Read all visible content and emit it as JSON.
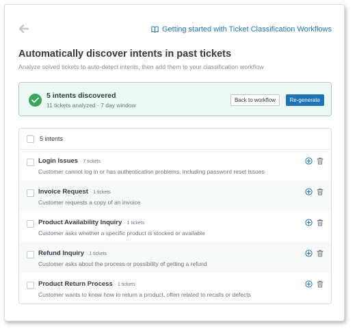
{
  "header": {
    "help_link": "Getting started with Ticket Classification Workflows"
  },
  "page": {
    "title": "Automatically discover intents in past tickets",
    "subtitle": "Analyze solved tickets to auto-detect intents, then add them to your classification workflow"
  },
  "result": {
    "title": "5 intents discovered",
    "subtitle": "11 tickets analyzed · 7 day window",
    "back_label": "Back to workflow",
    "regenerate_label": "Re-generate"
  },
  "list": {
    "header_label": "5 intents",
    "items": [
      {
        "name": "Login Issues",
        "count": "· 7 tickets",
        "description": "Customer cannot log in or has authentication problems, including password reset issues"
      },
      {
        "name": "Invoice Request",
        "count": "· 1 tickets",
        "description": "Customer requests a copy of an invoice"
      },
      {
        "name": "Product Availability Inquiry",
        "count": "· 1 tickets",
        "description": "Customer asks whether a specific product is stocked or available"
      },
      {
        "name": "Refund Inquiry",
        "count": "· 1 tickets",
        "description": "Customer asks about the process or possibility of getting a refund"
      },
      {
        "name": "Product Return Process",
        "count": "· 1 tickets",
        "description": "Customer wants to know how to return a product, often related to recalls or defects"
      }
    ]
  },
  "colors": {
    "accent": "#1f73b7",
    "success": "#3ba55c",
    "success_bg": "#edf8f4"
  },
  "icons": {
    "back": "arrow-left-icon",
    "help": "book-icon",
    "success": "check-circle-icon",
    "add": "plus-circle-icon",
    "delete": "trash-icon"
  }
}
